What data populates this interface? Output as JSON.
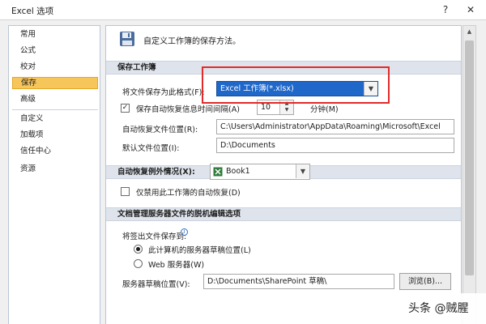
{
  "window": {
    "title": "Excel 选项",
    "help_label": "?",
    "close_label": "✕"
  },
  "sidebar": {
    "items": [
      {
        "label": "常用"
      },
      {
        "label": "公式"
      },
      {
        "label": "校对"
      },
      {
        "label": "保存",
        "selected": true
      },
      {
        "label": "高级"
      },
      {
        "label": "自定义"
      },
      {
        "label": "加载项"
      },
      {
        "label": "信任中心"
      },
      {
        "label": "资源"
      }
    ]
  },
  "header": {
    "icon": "floppy-disk-icon",
    "text": "自定义工作簿的保存方法。"
  },
  "save_section": {
    "title": "保存工作簿",
    "format_label": "将文件保存为此格式(F):",
    "format_value": "Excel 工作簿(*.xlsx)",
    "autorecover_label": "保存自动恢复信息时间间隔(A)",
    "autorecover_checked": true,
    "autorecover_minutes": "10",
    "minutes_unit": "分钟(M)",
    "autorecover_location_label": "自动恢复文件位置(R):",
    "autorecover_location_value": "C:\\Users\\Administrator\\AppData\\Roaming\\Microsoft\\Excel",
    "default_location_label": "默认文件位置(I):",
    "default_location_value": "D:\\Documents"
  },
  "exceptions_section": {
    "title": "自动恢复例外情况(X):",
    "workbook_value": "Book1",
    "disable_label": "仅禁用此工作簿的自动恢复(D)",
    "disable_checked": false
  },
  "offline_section": {
    "title": "文档管理服务器文件的脱机编辑选项",
    "save_to_label": "将签出文件保存到:",
    "option_local": "此计算机的服务器草稿位置(L)",
    "option_web": "Web 服务器(W)",
    "selected_option": "local",
    "drafts_label": "服务器草稿位置(V):",
    "drafts_value": "D:\\Documents\\SharePoint 草稿\\",
    "browse_label": "浏览(B)..."
  },
  "watermark": {
    "text": "头条 @贼腥"
  }
}
